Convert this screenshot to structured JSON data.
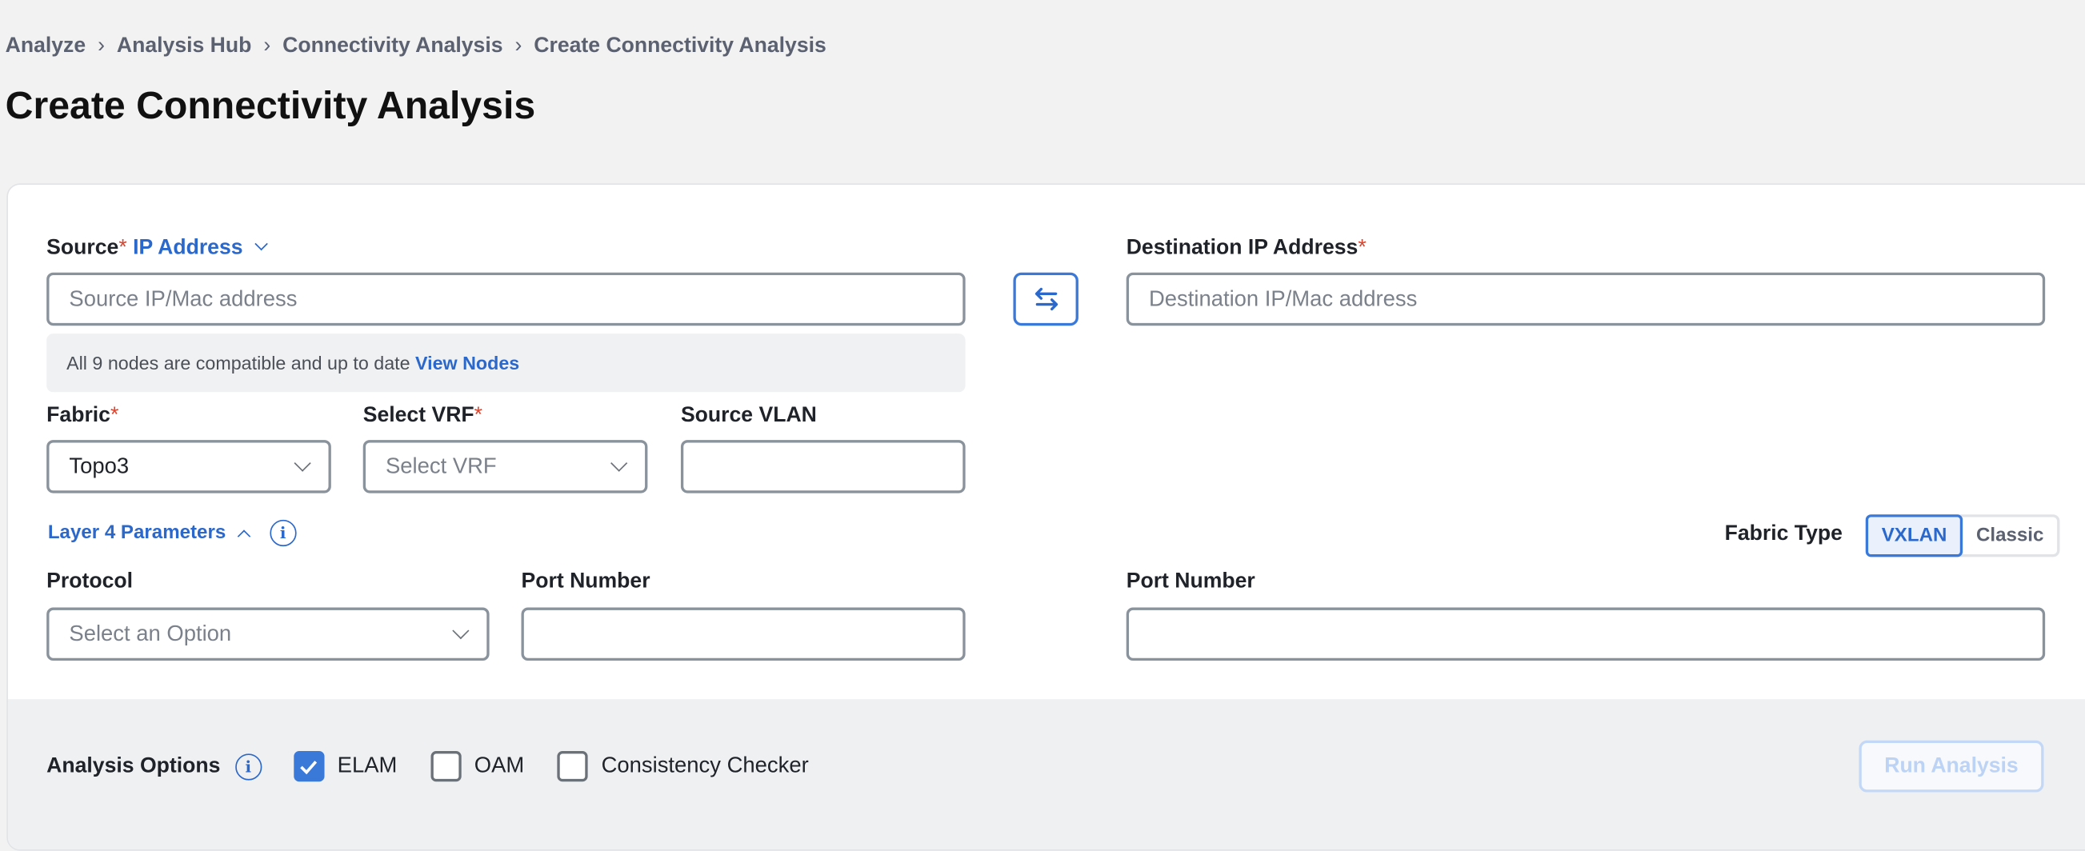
{
  "breadcrumb": [
    "Analyze",
    "Analysis Hub",
    "Connectivity Analysis",
    "Create Connectivity Analysis"
  ],
  "page_title": "Create Connectivity Analysis",
  "source": {
    "label": "Source",
    "type_selector": "IP Address",
    "placeholder": "Source IP/Mac address",
    "value": ""
  },
  "destination": {
    "label": "Destination IP Address",
    "placeholder": "Destination IP/Mac address",
    "value": ""
  },
  "info": {
    "text": "All 9 nodes are compatible and up to date",
    "link": "View Nodes"
  },
  "fabric": {
    "label": "Fabric",
    "value": "Topo3"
  },
  "vrf": {
    "label": "Select VRF",
    "placeholder": "Select VRF"
  },
  "source_vlan": {
    "label": "Source VLAN",
    "value": ""
  },
  "layer4": {
    "label": "Layer 4 Parameters",
    "expanded": true
  },
  "fabric_type": {
    "label": "Fabric Type",
    "options": [
      "VXLAN",
      "Classic"
    ],
    "selected": "VXLAN"
  },
  "protocol": {
    "label": "Protocol",
    "placeholder": "Select an Option"
  },
  "source_port": {
    "label": "Port Number",
    "value": ""
  },
  "dest_port": {
    "label": "Port Number",
    "value": ""
  },
  "analysis_options": {
    "label": "Analysis Options",
    "items": [
      {
        "label": "ELAM",
        "checked": true
      },
      {
        "label": "OAM",
        "checked": false
      },
      {
        "label": "Consistency Checker",
        "checked": false
      }
    ]
  },
  "run_button": {
    "label": "Run Analysis",
    "disabled": true
  },
  "required_mark": "*",
  "colors": {
    "accent": "#3b79d8",
    "link": "#2b68cc",
    "required": "#d9452f"
  }
}
